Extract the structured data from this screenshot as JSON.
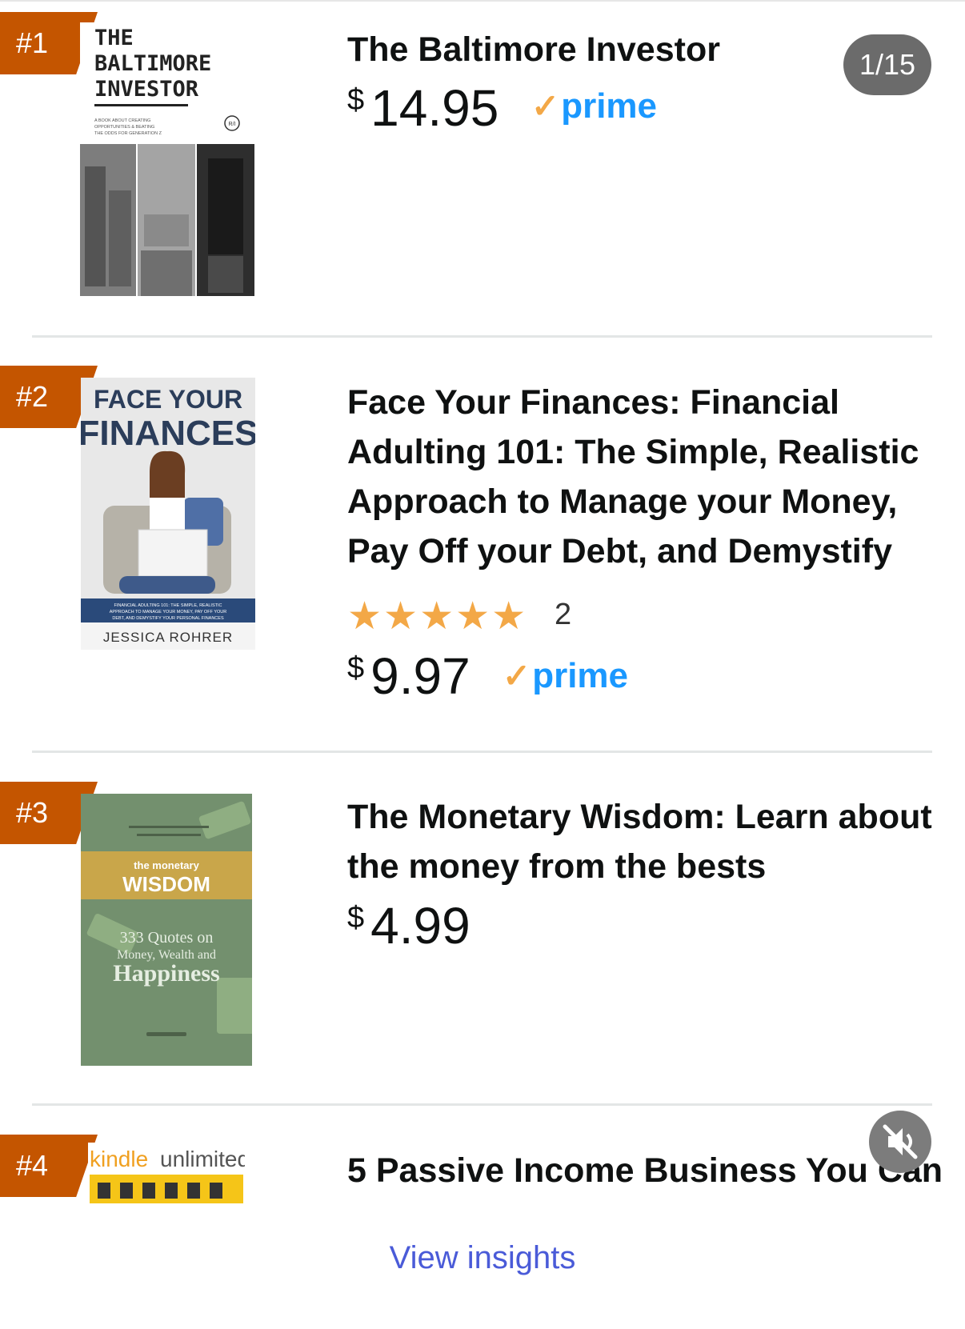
{
  "viewer": {
    "counter": "1/15"
  },
  "items": [
    {
      "rank": "#1",
      "title": "The Baltimore Investor",
      "price_symbol": "$",
      "price": "14.95",
      "prime": "prime",
      "cover": {
        "title_lines": [
          "THE",
          "BALTIMORE",
          "INVESTOR"
        ],
        "subtitle_lines": [
          "A BOOK ABOUT CREATING",
          "OPPORTUNITIES & BEATING",
          "THE ODDS FOR GENERATION Z"
        ],
        "logo": "R/I"
      }
    },
    {
      "rank": "#2",
      "title": "Face Your Finances: Financial Adulting 101: The Simple, Realistic Approach to Manage your Money, Pay Off your Debt, and Demystify",
      "rating_stars": 5,
      "rating_count": "2",
      "price_symbol": "$",
      "price": "9.97",
      "prime": "prime",
      "cover": {
        "line1": "FACE YOUR",
        "line2": "FINANCES",
        "blurb_lines": [
          "FINANCIAL ADULTING 101: THE SIMPLE, REALISTIC",
          "APPROACH TO MANAGE YOUR MONEY, PAY OFF YOUR",
          "DEBT, AND DEMYSTIFY YOUR PERSONAL FINANCES"
        ],
        "author": "JESSICA ROHRER"
      }
    },
    {
      "rank": "#3",
      "title": "The Monetary Wisdom: Learn about the money from the bests",
      "price_symbol": "$",
      "price": "4.99",
      "cover": {
        "small": "the monetary",
        "big": "WISDOM",
        "q1": "333 Quotes on",
        "q2": "Money, Wealth and",
        "q3": "Happiness"
      }
    },
    {
      "rank": "#4",
      "title": "5 Passive Income Business You Can",
      "cover": {
        "brand_a": "kindle",
        "brand_b": "unlimited"
      }
    }
  ],
  "footer": {
    "link": "View insights"
  },
  "colors": {
    "rank_badge": "#c45500",
    "prime_blue": "#1a98ff",
    "prime_check": "#f3a847",
    "star": "#f3a847",
    "link": "#4a5bd8"
  }
}
